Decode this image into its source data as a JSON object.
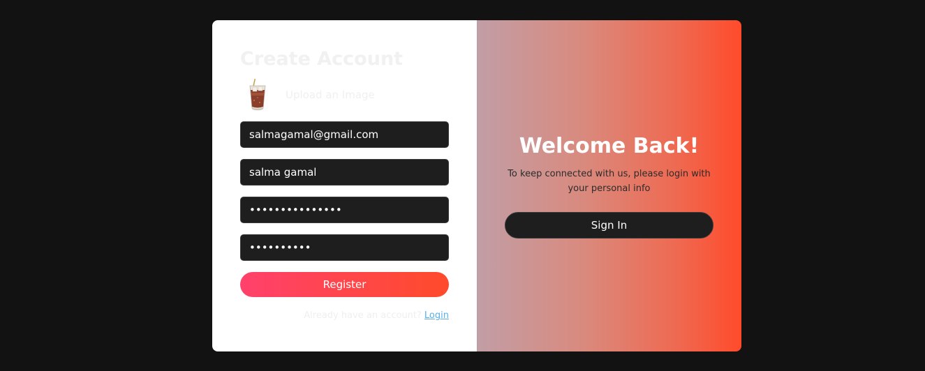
{
  "register": {
    "title": "Create Account",
    "upload_label": "Upload an Image",
    "email_value": "salmagamal@gmail.com",
    "name_value": "salma gamal",
    "password_value": "•••••••••••••••",
    "confirm_password_value": "••••••••••",
    "register_label": "Register",
    "already_text": "Already have an account?",
    "login_label": "Login"
  },
  "panel": {
    "heading": "Welcome Back!",
    "subtext": "To keep connected with us, please login with your personal info",
    "signin_label": "Sign In"
  },
  "colors": {
    "page_bg": "#121212",
    "gradient_start": "#ff416c",
    "gradient_end": "#ff4b2b",
    "input_bg": "#1e1e1e",
    "link": "#5aaeea"
  },
  "icons": {
    "avatar": "iced-drink-glass-image"
  }
}
